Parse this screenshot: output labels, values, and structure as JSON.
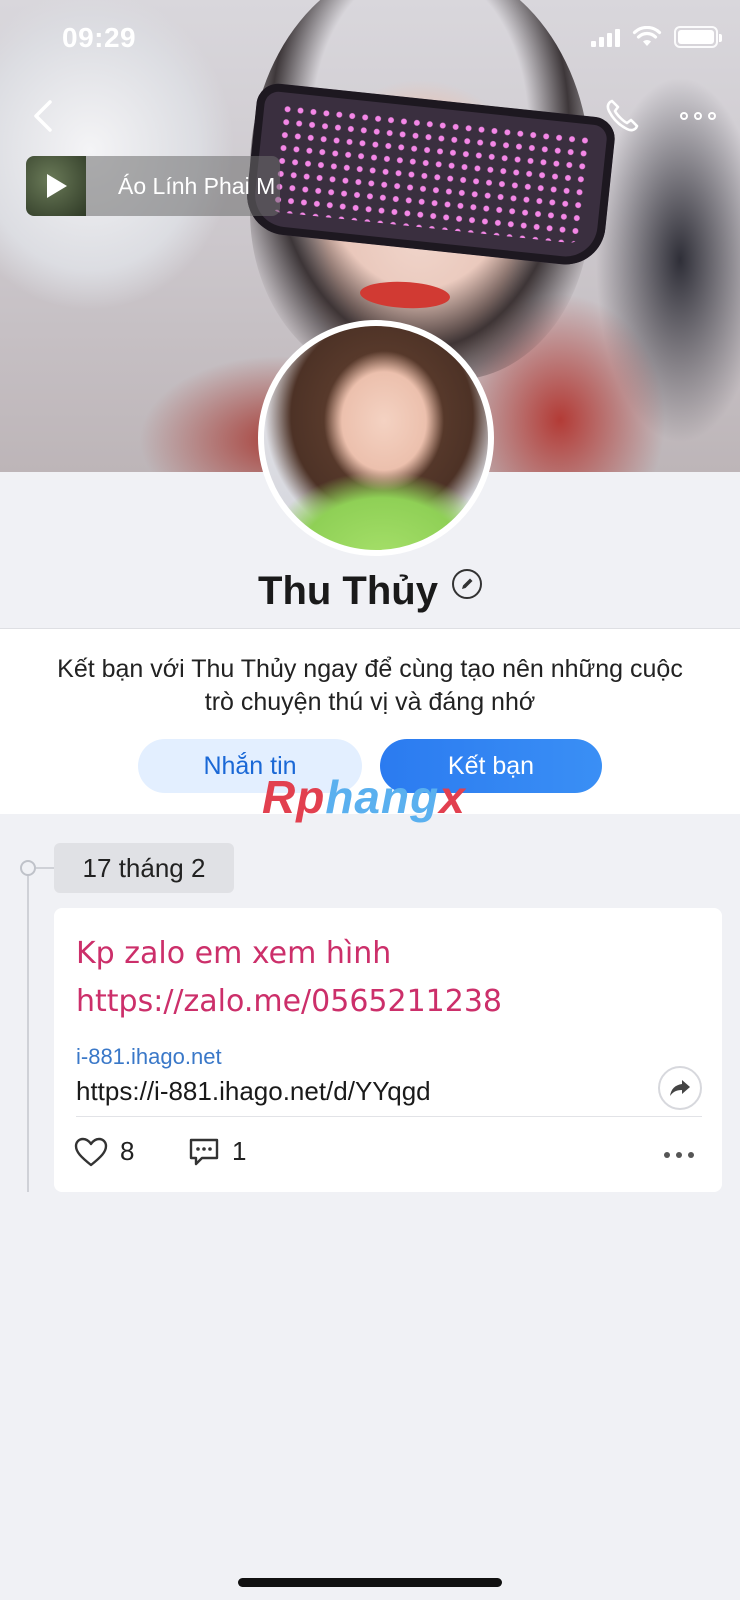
{
  "status_bar": {
    "time": "09:29"
  },
  "header": {
    "music_title": "Áo Lính Phai M",
    "back_icon": "chevron-left-icon",
    "call_icon": "phone-icon",
    "more_icon": "more-horizontal-icon"
  },
  "profile": {
    "name": "Thu Thủy",
    "edit_icon": "pencil-icon"
  },
  "friend_prompt": {
    "message": "Kết bạn với Thu Thủy ngay để cùng tạo nên những cuộc trò chuyện thú vị và đáng nhớ",
    "message_button": "Nhắn tin",
    "add_friend_button": "Kết bạn"
  },
  "watermark": {
    "part1": "Rp",
    "part2": "hang",
    "part3": "x"
  },
  "timeline": {
    "date": "17 tháng 2",
    "post": {
      "text": "Kp zalo em xem hình https://zalo.me/0565211238",
      "link_domain": "i-881.ihago.net",
      "link_url": "https://i-881.ihago.net/d/YYqgd",
      "likes": "8",
      "comments": "1"
    }
  },
  "colors": {
    "primary": "#2b7bf0",
    "post_text": "#cc2f6a",
    "link": "#3a78c8"
  }
}
